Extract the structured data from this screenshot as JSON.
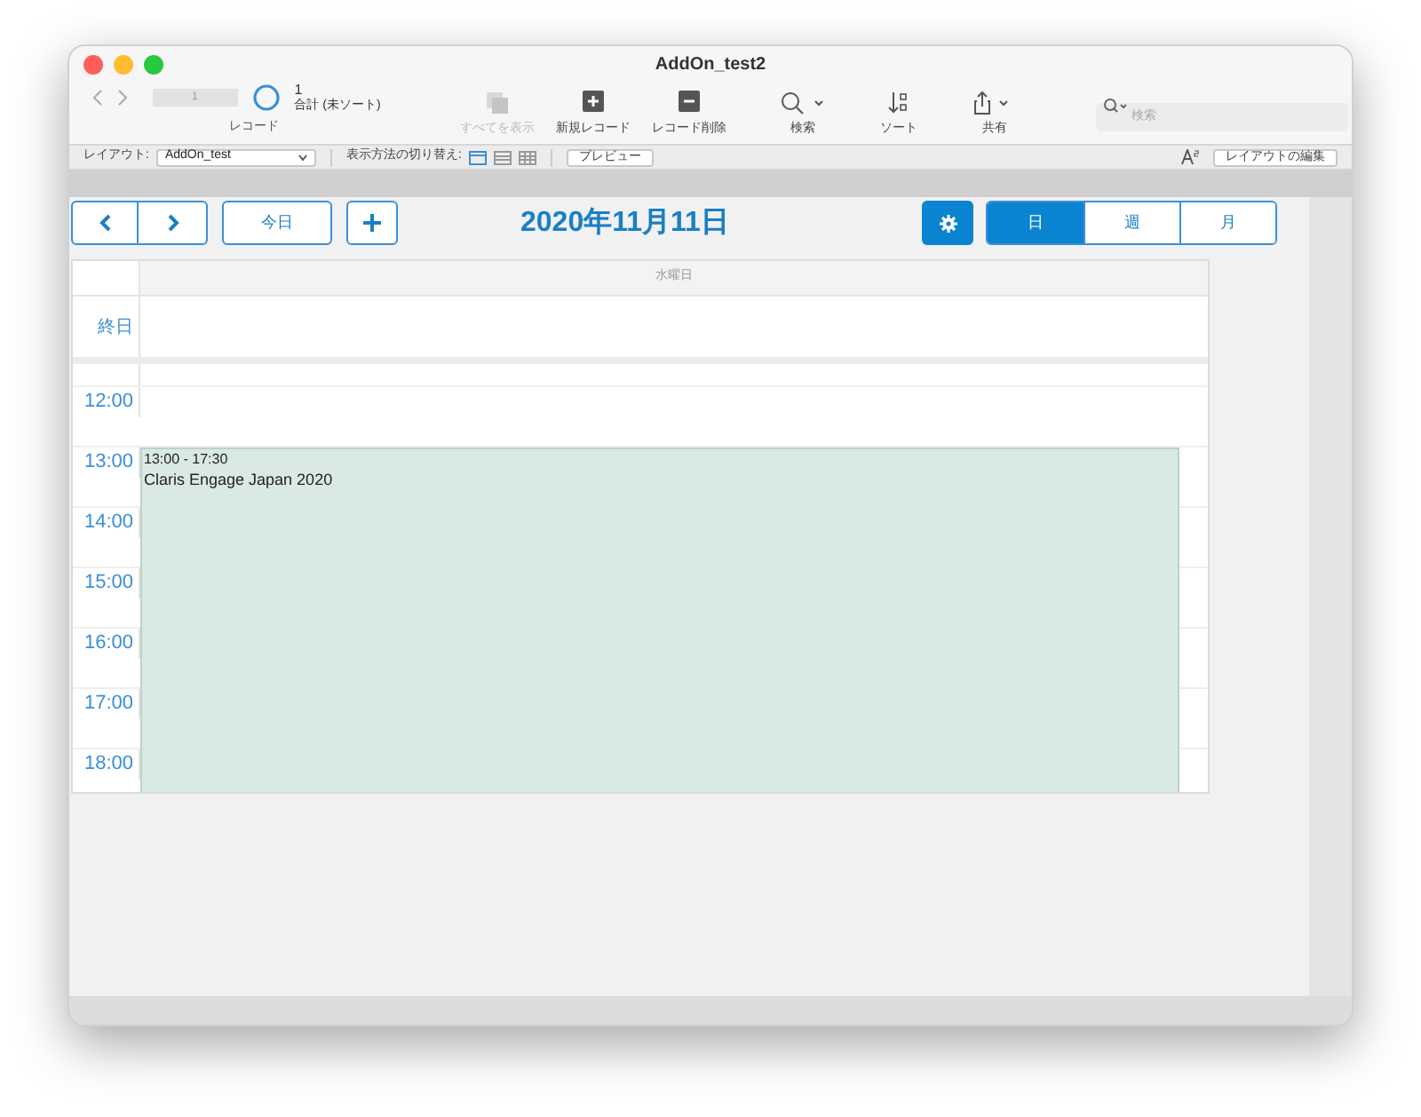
{
  "window": {
    "title": "AddOn_test2"
  },
  "toolbar": {
    "record_field": "1",
    "record_count": "1",
    "record_status": "合計 (未ソート)",
    "record_label": "レコード",
    "buttons": [
      {
        "label": "すべてを表示",
        "disabled": true
      },
      {
        "label": "新規レコード",
        "disabled": false
      },
      {
        "label": "レコード削除",
        "disabled": false
      },
      {
        "label": "検索",
        "disabled": false
      },
      {
        "label": "ソート",
        "disabled": false
      },
      {
        "label": "共有",
        "disabled": false
      }
    ],
    "search": {
      "placeholder": "検索"
    }
  },
  "layout_bar": {
    "layout_label": "レイアウト:",
    "layout_value": "AddOn_test",
    "view_label": "表示方法の切り替え:",
    "views": [
      {
        "selected": true
      },
      {
        "selected": false
      },
      {
        "selected": false
      }
    ],
    "preview": "プレビュー",
    "edit_layout": "レイアウトの編集"
  },
  "calendar": {
    "today": "今日",
    "title": "2020年11月11日",
    "views": [
      {
        "label": "日",
        "selected": true
      },
      {
        "label": "週",
        "selected": false
      },
      {
        "label": "月",
        "selected": false
      }
    ],
    "day_header": "水曜日",
    "all_day": "終日",
    "hours": [
      "12:00",
      "13:00",
      "14:00",
      "15:00",
      "16:00",
      "17:00",
      "18:00"
    ],
    "events": [
      {
        "time": "13:00 - 17:30",
        "title": "Claris Engage Japan 2020"
      }
    ]
  }
}
